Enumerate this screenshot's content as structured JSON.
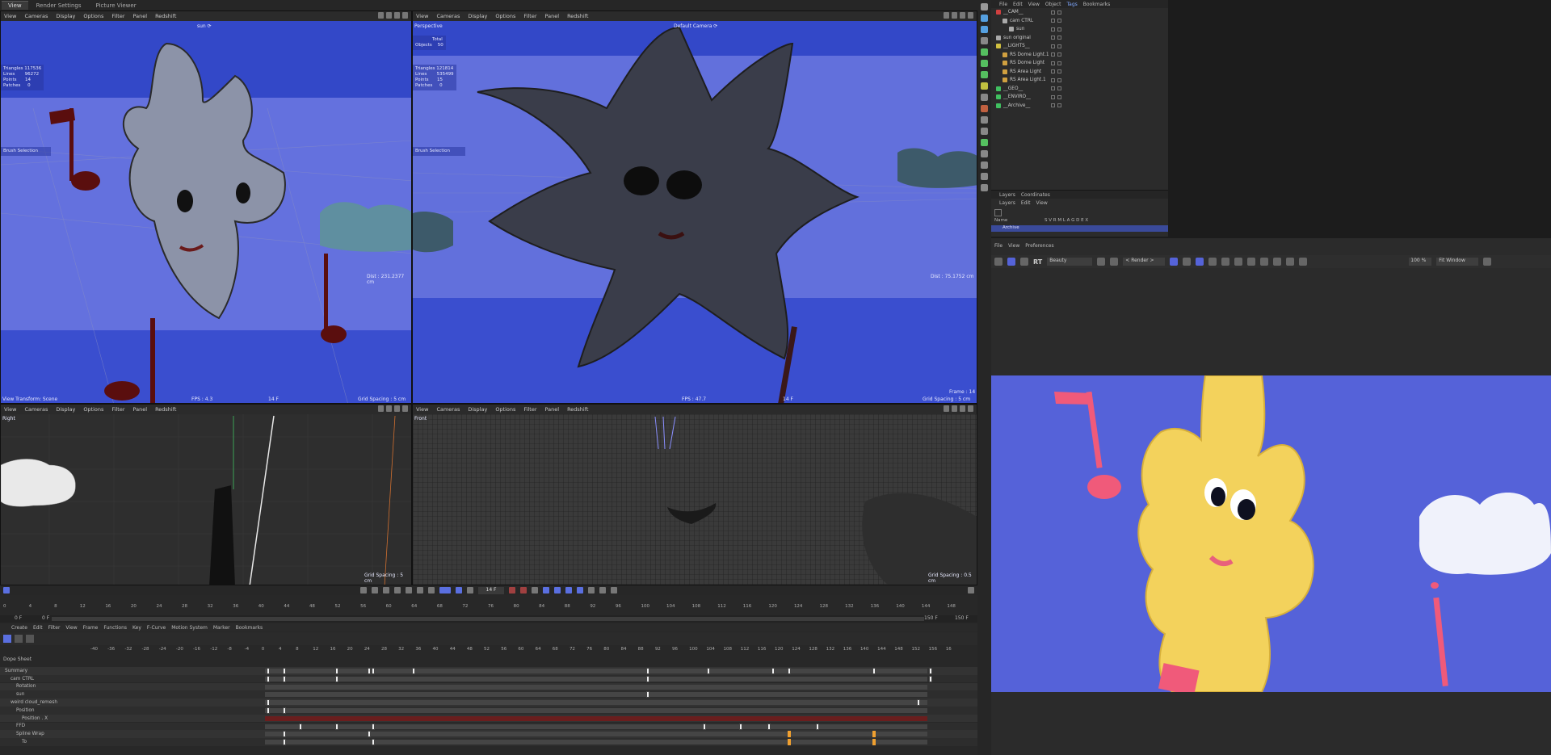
{
  "top_tabs": [
    "View",
    "Render Settings",
    "Picture Viewer"
  ],
  "viewport_menu": [
    "View",
    "Cameras",
    "Display",
    "Options",
    "Filter",
    "Panel",
    "Redshift"
  ],
  "vp1": {
    "camera": "sun ⟳",
    "hud": "Triangles 117536\nLines       96272\nPoints      14\nPatches     0",
    "brush": "Brush Selection",
    "dist": "Dist : 231.2377 cm",
    "footer_left": "View Transform: Scene",
    "fps": "FPS : 4.3",
    "frame": "14 F",
    "grid": "Grid Spacing : 5 cm"
  },
  "vp2": {
    "name": "Perspective",
    "camera": "Default Camera ⟳",
    "hud": "            Total\nObjects    50",
    "hud2": "Triangles 121814\nLines       535499\nPoints      15\nPatches     0",
    "brush": "Brush Selection",
    "dist": "Dist : 75.1752 cm",
    "fps": "FPS : 47.7",
    "frame": "14 F",
    "frame_right": "Frame : 14",
    "grid": "Grid Spacing : 5 cm"
  },
  "vp3": {
    "name": "Right",
    "grid": "Grid Spacing : 5 cm"
  },
  "vp4": {
    "name": "Front",
    "grid": "Grid Spacing : 0.5 cm"
  },
  "object_manager": {
    "menu": [
      "File",
      "Edit",
      "View",
      "Object",
      "Tags",
      "Bookmarks"
    ],
    "rows": [
      {
        "label": "__CAM__",
        "indent": 0,
        "color": "#d04040"
      },
      {
        "label": "cam CTRL",
        "indent": 1,
        "color": "#aaaaaa"
      },
      {
        "label": "sun",
        "indent": 2,
        "color": "#aaaaaa"
      },
      {
        "label": "sun original",
        "indent": 0,
        "color": "#aaaaaa"
      },
      {
        "label": "__LIGHTS__",
        "indent": 0,
        "color": "#d0c040"
      },
      {
        "label": "RS Dome Light.1",
        "indent": 1,
        "color": "#d0a040"
      },
      {
        "label": "RS Dome Light",
        "indent": 1,
        "color": "#d0a040"
      },
      {
        "label": "RS Area Light",
        "indent": 1,
        "color": "#d0a040"
      },
      {
        "label": "RS Area Light.1",
        "indent": 1,
        "color": "#d0a040"
      },
      {
        "label": "__GEO__",
        "indent": 0,
        "color": "#40c060"
      },
      {
        "label": "__ENVIRO__",
        "indent": 0,
        "color": "#40c060"
      },
      {
        "label": "__Archive__",
        "indent": 0,
        "color": "#40c060"
      }
    ]
  },
  "layers": {
    "tabs": [
      "Layers",
      "Coordinates"
    ],
    "menu": [
      "Layers",
      "Edit",
      "View"
    ],
    "header_name": "Name",
    "header_flags": "S V R M L A G D E X",
    "row": "Archive"
  },
  "render_view": {
    "menu": [
      "File",
      "View",
      "Preferences"
    ],
    "rt": "RT",
    "beauty": "Beauty",
    "render_target": "< Render >",
    "zoom": "100 %",
    "fit": "Fit Window"
  },
  "timeline": {
    "ruler": [
      "0",
      "4",
      "8",
      "12",
      "16",
      "20",
      "24",
      "28",
      "32",
      "36",
      "40",
      "44",
      "48",
      "52",
      "56",
      "60",
      "64",
      "68",
      "72",
      "76",
      "80",
      "84",
      "88",
      "92",
      "96",
      "100",
      "104",
      "108",
      "112",
      "116",
      "120",
      "124",
      "128",
      "132",
      "136",
      "140",
      "144",
      "148"
    ],
    "current_frame": "14 F",
    "start": "0 F",
    "start2": "0 F",
    "end": "150 F",
    "end2": "150 F",
    "menu": [
      "Create",
      "Edit",
      "Filter",
      "View",
      "Frame",
      "Functions",
      "Key",
      "F-Curve",
      "Motion System",
      "Marker",
      "Bookmarks"
    ],
    "dope_label": "Dope Sheet",
    "ruler2": [
      "-40",
      "-36",
      "-32",
      "-28",
      "-24",
      "-20",
      "-16",
      "-12",
      "-8",
      "-4",
      "0",
      "4",
      "8",
      "12",
      "16",
      "20",
      "24",
      "28",
      "32",
      "36",
      "40",
      "44",
      "48",
      "52",
      "56",
      "60",
      "64",
      "68",
      "72",
      "76",
      "80",
      "84",
      "88",
      "92",
      "96",
      "100",
      "104",
      "108",
      "112",
      "116",
      "120",
      "124",
      "128",
      "132",
      "136",
      "140",
      "144",
      "148",
      "152",
      "156",
      "16"
    ],
    "tracks": [
      {
        "label": "Summary"
      },
      {
        "label": "cam CTRL"
      },
      {
        "label": "Rotation"
      },
      {
        "label": "sun"
      },
      {
        "label": "weird cloud_remesh"
      },
      {
        "label": "Position"
      },
      {
        "label": "Position . X"
      },
      {
        "label": "FFD"
      },
      {
        "label": "Spline Wrap"
      },
      {
        "label": "To"
      }
    ]
  }
}
